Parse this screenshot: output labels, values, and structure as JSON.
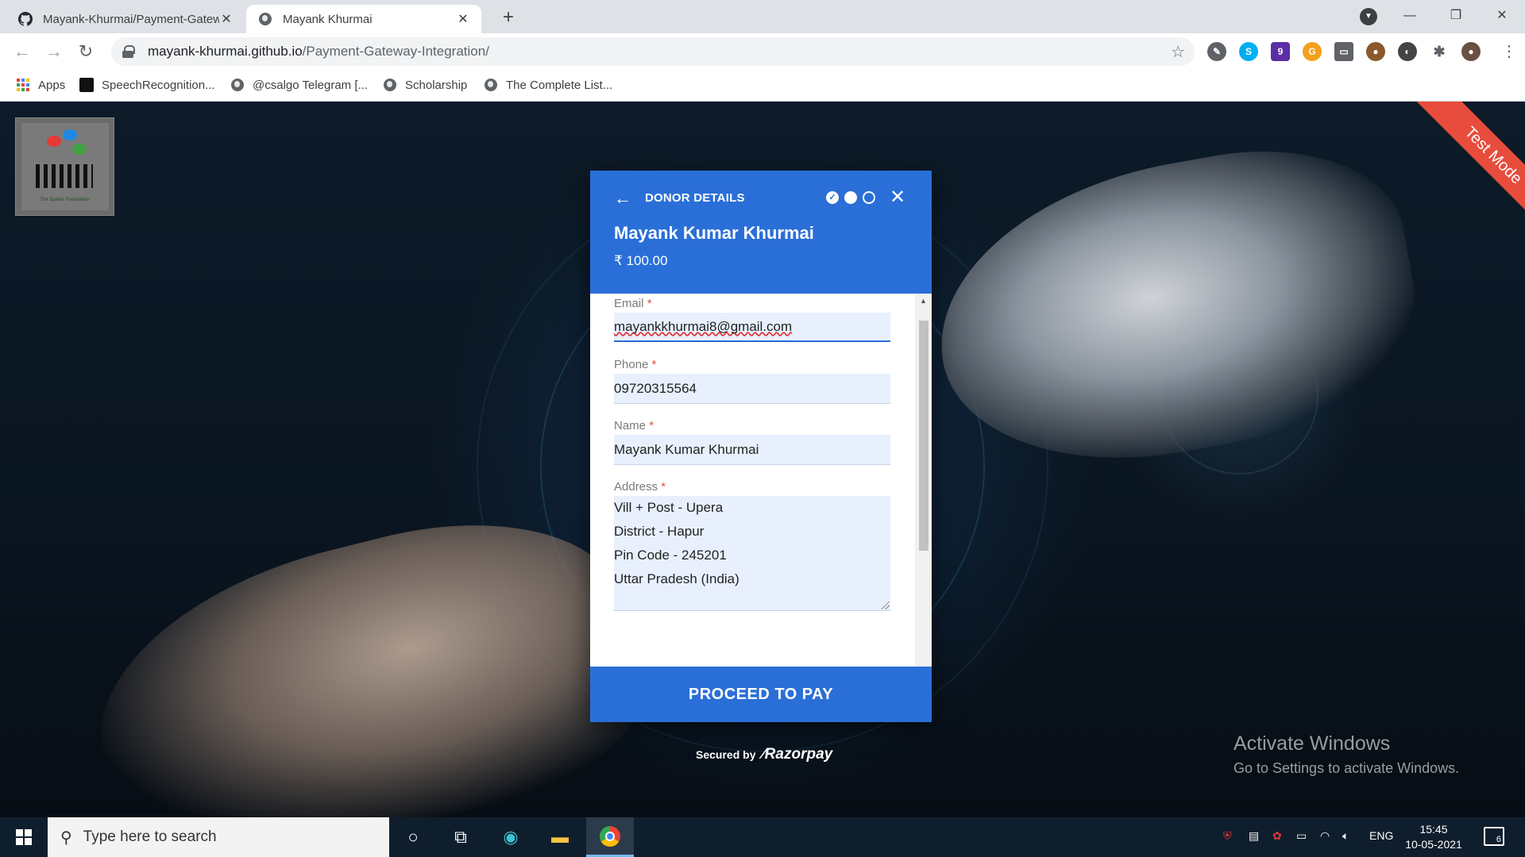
{
  "browser": {
    "tabs": [
      {
        "title": "Mayank-Khurmai/Payment-Gateway-Integration",
        "icon": "github-icon",
        "active": false
      },
      {
        "title": "Mayank Khurmai",
        "icon": "globe-icon",
        "active": true
      }
    ],
    "url_host": "mayank-khurmai.github.io",
    "url_path": "/Payment-Gateway-Integration/",
    "bookmarks": [
      {
        "label": "Apps",
        "icon": "apps-grid-icon"
      },
      {
        "label": "SpeechRecognition...",
        "icon": "bookmark-favicon-icon"
      },
      {
        "label": "@csalgo Telegram [...",
        "icon": "globe-icon"
      },
      {
        "label": "Scholarship",
        "icon": "globe-icon"
      },
      {
        "label": "The Complete List...",
        "icon": "globe-icon"
      }
    ],
    "extension_badge": "9"
  },
  "page": {
    "logo_caption": "The Sparks Foundation",
    "ribbon_text": "Test Mode",
    "activate_title": "Activate Windows",
    "activate_subtitle": "Go to Settings to activate Windows."
  },
  "checkout": {
    "step_title": "DONOR DETAILS",
    "merchant_name": "Mayank Kumar Khurmai",
    "amount": "₹ 100.00",
    "fields": {
      "email": {
        "label": "Email",
        "value": "mayankkhurmai8@gmail.com"
      },
      "phone": {
        "label": "Phone",
        "value": "09720315564"
      },
      "name": {
        "label": "Name",
        "value": "Mayank Kumar Khurmai"
      },
      "address": {
        "label": "Address",
        "value": "Vill + Post - Upera\nDistrict - Hapur\nPin Code - 245201\nUttar Pradesh (India)"
      }
    },
    "required_mark": "*",
    "pay_button": "PROCEED TO PAY",
    "secured_by": "Secured by",
    "brand": "Razorpay",
    "colors": {
      "primary": "#2a6fd8",
      "ribbon": "#e74c3c"
    }
  },
  "taskbar": {
    "search_placeholder": "Type here to search",
    "language": "ENG",
    "time": "15:45",
    "date": "10-05-2021",
    "notifications": "6"
  }
}
